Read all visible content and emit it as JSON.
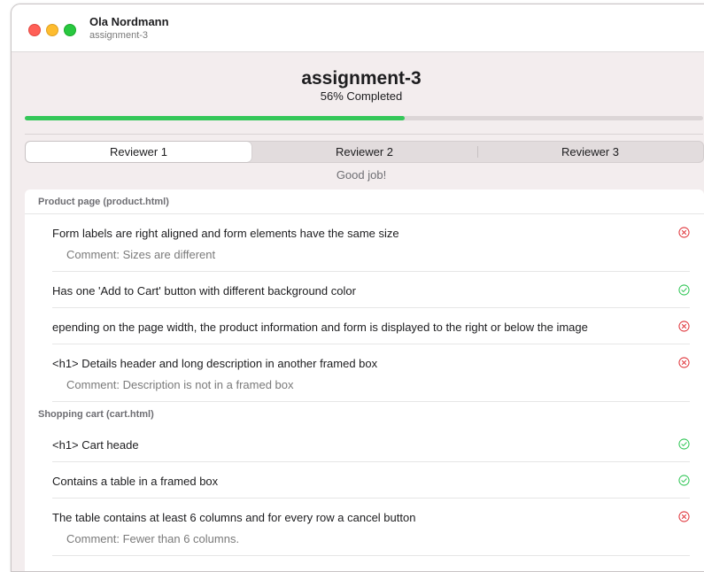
{
  "window": {
    "user_name": "Ola Nordmann",
    "assignment_name": "assignment-3"
  },
  "header": {
    "title": "assignment-3",
    "completion_text": "56% Completed",
    "progress": 0.56,
    "progress_color": "#34c759"
  },
  "tabs": [
    {
      "label": "Reviewer 1",
      "selected": true
    },
    {
      "label": "Reviewer 2",
      "selected": false
    },
    {
      "label": "Reviewer 3",
      "selected": false
    }
  ],
  "feedback": "Good job!",
  "colors": {
    "pass": "#34c759",
    "fail": "#e0383e"
  },
  "sections": [
    {
      "title": "Product page (product.html)",
      "items": [
        {
          "text": "Form labels are right aligned and form elements have the same size",
          "status": "fail",
          "icon": "x-circle-icon",
          "comment": "Comment: Sizes are different"
        },
        {
          "text": "Has one 'Add to Cart' button with different background color",
          "status": "pass",
          "icon": "check-circle-icon",
          "comment": ""
        },
        {
          "text": "epending on the page width, the product information and form is displayed to the right or below the image",
          "status": "fail",
          "icon": "x-circle-icon",
          "comment": ""
        },
        {
          "text": "<h1> Details header and long description in another framed box",
          "status": "fail",
          "icon": "x-circle-icon",
          "comment": "Comment: Description is not in a framed box"
        }
      ]
    },
    {
      "title": "Shopping cart (cart.html)",
      "items": [
        {
          "text": "<h1> Cart heade",
          "status": "pass",
          "icon": "check-circle-icon",
          "comment": ""
        },
        {
          "text": "Contains a table in a framed box",
          "status": "pass",
          "icon": "check-circle-icon",
          "comment": ""
        },
        {
          "text": "The table contains at least 6 columns and for every row a cancel button",
          "status": "fail",
          "icon": "x-circle-icon",
          "comment": "Comment: Fewer than 6 columns."
        }
      ]
    }
  ]
}
